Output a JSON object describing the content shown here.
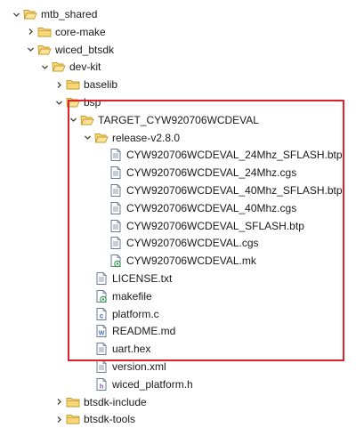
{
  "tree": [
    {
      "label": "mtb_shared",
      "type": "folder",
      "expanded": true,
      "depth": 0
    },
    {
      "label": "core-make",
      "type": "folder",
      "expanded": false,
      "depth": 1
    },
    {
      "label": "wiced_btsdk",
      "type": "folder",
      "expanded": true,
      "depth": 1
    },
    {
      "label": "dev-kit",
      "type": "folder",
      "expanded": true,
      "depth": 2
    },
    {
      "label": "baselib",
      "type": "folder",
      "expanded": false,
      "depth": 3
    },
    {
      "label": "bsp",
      "type": "folder",
      "expanded": true,
      "depth": 3
    },
    {
      "label": "TARGET_CYW920706WCDEVAL",
      "type": "folder",
      "expanded": true,
      "depth": 4
    },
    {
      "label": "release-v2.8.0",
      "type": "folder",
      "expanded": true,
      "depth": 5
    },
    {
      "label": "CYW920706WCDEVAL_24Mhz_SFLASH.btp",
      "type": "file-text",
      "depth": 6
    },
    {
      "label": "CYW920706WCDEVAL_24Mhz.cgs",
      "type": "file-text",
      "depth": 6
    },
    {
      "label": "CYW920706WCDEVAL_40Mhz_SFLASH.btp",
      "type": "file-text",
      "depth": 6
    },
    {
      "label": "CYW920706WCDEVAL_40Mhz.cgs",
      "type": "file-text",
      "depth": 6
    },
    {
      "label": "CYW920706WCDEVAL_SFLASH.btp",
      "type": "file-text",
      "depth": 6
    },
    {
      "label": "CYW920706WCDEVAL.cgs",
      "type": "file-text",
      "depth": 6
    },
    {
      "label": "CYW920706WCDEVAL.mk",
      "type": "file-make",
      "depth": 6
    },
    {
      "label": "LICENSE.txt",
      "type": "file-text",
      "depth": 5
    },
    {
      "label": "makefile",
      "type": "file-make",
      "depth": 5
    },
    {
      "label": "platform.c",
      "type": "file-c",
      "depth": 5
    },
    {
      "label": "README.md",
      "type": "file-md",
      "depth": 5
    },
    {
      "label": "uart.hex",
      "type": "file-text",
      "depth": 5
    },
    {
      "label": "version.xml",
      "type": "file-text",
      "depth": 5
    },
    {
      "label": "wiced_platform.h",
      "type": "file-h",
      "depth": 5
    },
    {
      "label": "btsdk-include",
      "type": "folder",
      "expanded": false,
      "depth": 3
    },
    {
      "label": "btsdk-tools",
      "type": "folder",
      "expanded": false,
      "depth": 3
    }
  ],
  "colors": {
    "folder_fill": "#f6d77a",
    "folder_stroke": "#c59a2a",
    "file_stroke": "#6b7b93",
    "make_accent": "#2e9b4a",
    "c_accent": "#3b6fb6",
    "md_accent": "#3b6fb6",
    "h_accent": "#7a5aa8",
    "highlight": "#e0202a"
  }
}
